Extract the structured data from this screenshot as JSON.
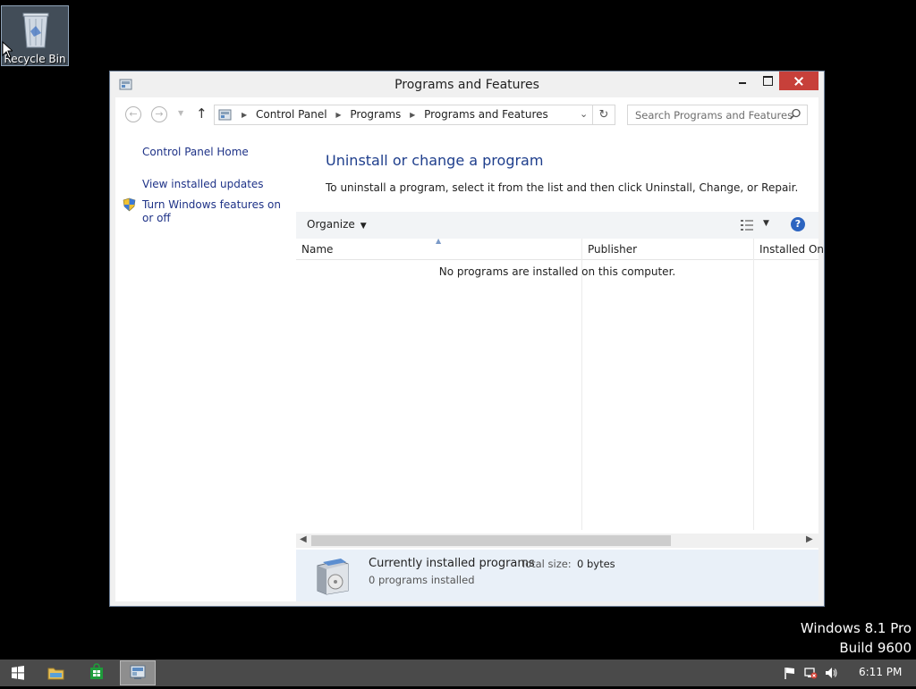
{
  "desktop": {
    "recycle_bin_label": "Recycle Bin",
    "watermark": {
      "line1": "Windows 8.1 Pro",
      "line2": "Build 9600"
    }
  },
  "window": {
    "title": "Programs and Features",
    "address": {
      "crumbs": [
        "Control Panel",
        "Programs",
        "Programs and Features"
      ]
    },
    "search_placeholder": "Search Programs and Features",
    "left_pane": {
      "home": "Control Panel Home",
      "updates": "View installed updates",
      "features": "Turn Windows features on or off"
    },
    "main": {
      "heading": "Uninstall or change a program",
      "instructions": "To uninstall a program, select it from the list and then click Uninstall, Change, or Repair.",
      "organize": "Organize",
      "columns": [
        "Name",
        "Publisher",
        "Installed On"
      ],
      "empty_message": "No programs are installed on this computer."
    },
    "details": {
      "title": "Currently installed programs",
      "size_label": "Total size:",
      "size_value": "0 bytes",
      "count": "0 programs installed"
    }
  },
  "taskbar": {
    "clock": "6:11 PM"
  },
  "colors": {
    "accent_close": "#c7403a",
    "link": "#1e3287",
    "heading": "#1e3e8c",
    "taskbar": "#4a4a4a"
  }
}
